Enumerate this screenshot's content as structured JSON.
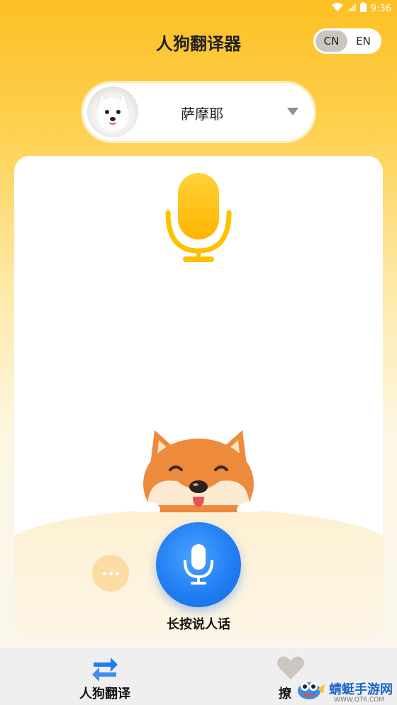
{
  "status_bar": {
    "time": "9:36"
  },
  "header": {
    "title": "人狗翻译器"
  },
  "language_toggle": {
    "options": [
      "CN",
      "EN"
    ],
    "selected": "CN"
  },
  "breed_selector": {
    "name": "萨摩耶"
  },
  "main": {
    "hold_hint": "长按说人话"
  },
  "tabbar": {
    "tabs": [
      {
        "label": "人狗翻译",
        "icon": "swap-arrows-icon",
        "active": true
      },
      {
        "label": "撩",
        "icon": "heart-icon",
        "active": false
      }
    ]
  },
  "watermark": {
    "name": "蜻蜓手游网",
    "url": "WWW.QT6.COM"
  },
  "colors": {
    "accent": "#fdc024",
    "primary_blue": "#1f7cf2",
    "tab_active": "#1f7cf2",
    "tab_inactive": "#cbc7c0"
  }
}
